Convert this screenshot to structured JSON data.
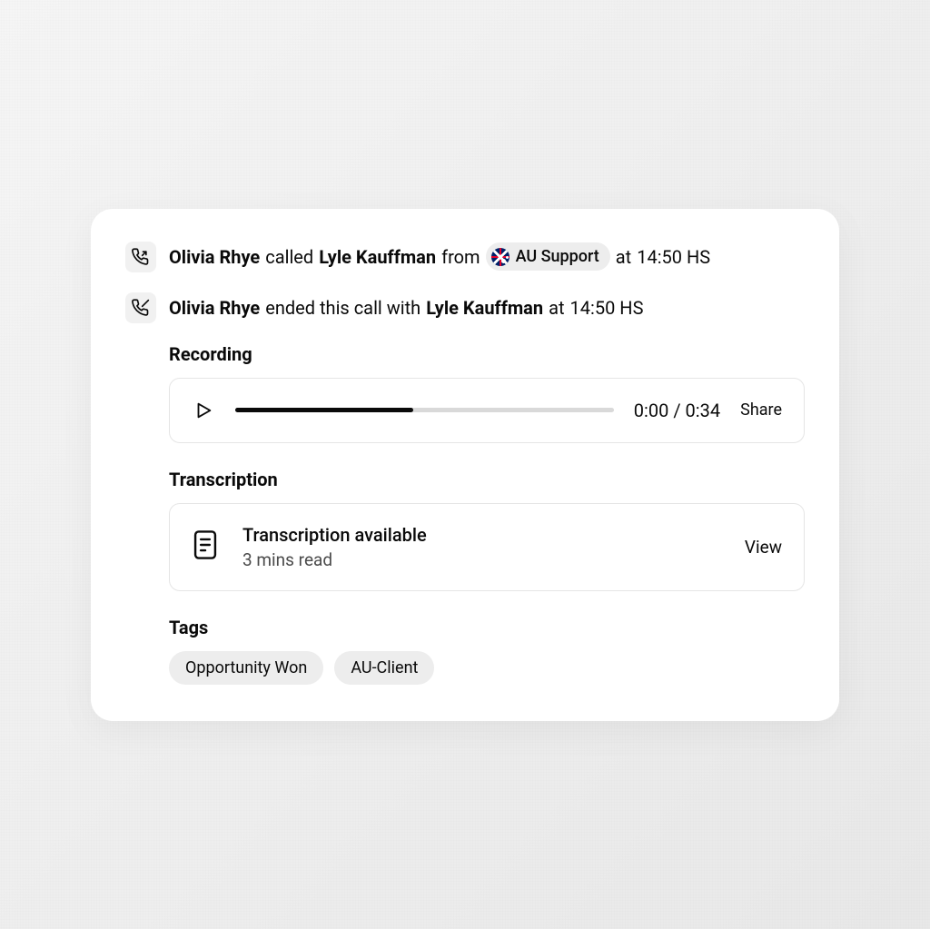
{
  "events": {
    "called": {
      "caller": "Olivia Rhye",
      "verb": "called",
      "callee": "Lyle Kauffman",
      "from_label": "from",
      "source": "AU Support",
      "at_label": "at",
      "time": "14:50 HS"
    },
    "ended": {
      "caller": "Olivia Rhye",
      "verb": "ended this call with",
      "callee": "Lyle Kauffman",
      "at_label": "at",
      "time": "14:50 HS"
    }
  },
  "recording": {
    "title": "Recording",
    "current_time": "0:00",
    "separator": "/",
    "duration": "0:34",
    "share_label": "Share",
    "progress_percent": 47
  },
  "transcription": {
    "title": "Transcription",
    "status": "Transcription available",
    "subtitle": "3 mins read",
    "view_label": "View"
  },
  "tags": {
    "title": "Tags",
    "items": [
      "Opportunity Won",
      "AU-Client"
    ]
  }
}
